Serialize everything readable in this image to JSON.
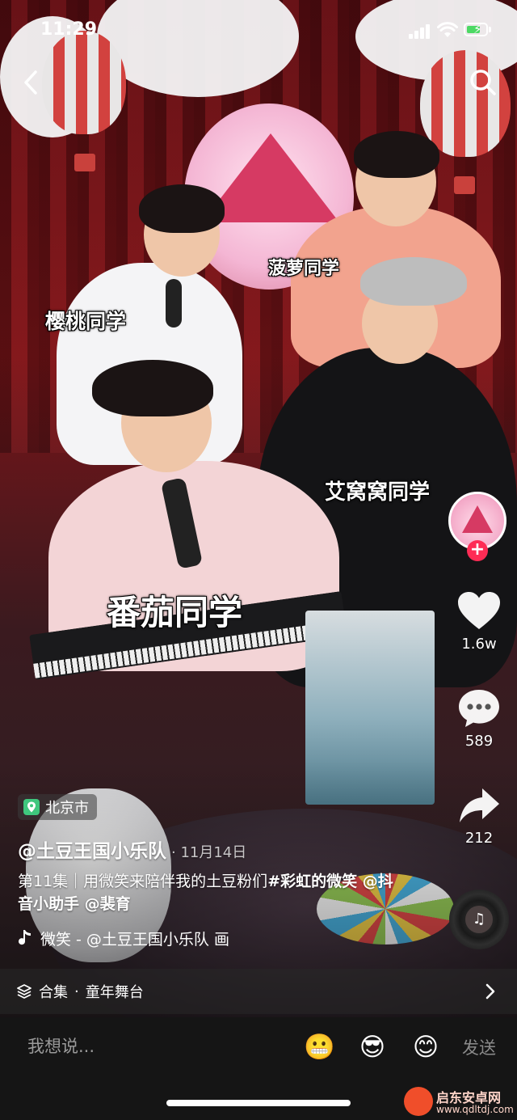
{
  "status_bar": {
    "time": "11:29"
  },
  "video": {
    "stickers": {
      "name_1": "菠萝同学",
      "name_2": "樱桃同学",
      "name_3": "艾窝窝同学",
      "name_4": "番茄同学"
    }
  },
  "rail": {
    "likes": "1.6w",
    "comments": "589",
    "shares": "212",
    "follow_symbol": "+"
  },
  "caption": {
    "location": "北京市",
    "author": "@土豆王国小乐队",
    "date": "· 11月14日",
    "description_1": "第11集｜用微笑来陪伴我的土豆粉们",
    "description_tag": "#彩虹的微笑",
    "description_2": " @抖音小助手 @裴育",
    "music": "微笑 - @土豆王国小乐队   画",
    "collection_label": "合集",
    "collection_sep": "·",
    "collection_name": "童年舞台"
  },
  "comment_bar": {
    "placeholder": "我想说...",
    "send_label": "发送",
    "emojis": [
      "😬",
      "😎",
      "😊"
    ]
  },
  "watermark": {
    "line1": "启东安卓网",
    "line2": "www.qdltdj.com"
  },
  "icons": {
    "back": "chevron-left-icon",
    "search": "search-icon",
    "like": "heart-icon",
    "comment": "comment-bubble-icon",
    "share": "share-arrow-icon",
    "location": "location-pin-icon",
    "music": "music-note-icon",
    "collection": "stack-icon",
    "expand": "chevron-right-icon"
  },
  "colors": {
    "accent": "#fe2c55",
    "location_pin": "#3fc77e",
    "comment_bar_bg": "#151515"
  }
}
